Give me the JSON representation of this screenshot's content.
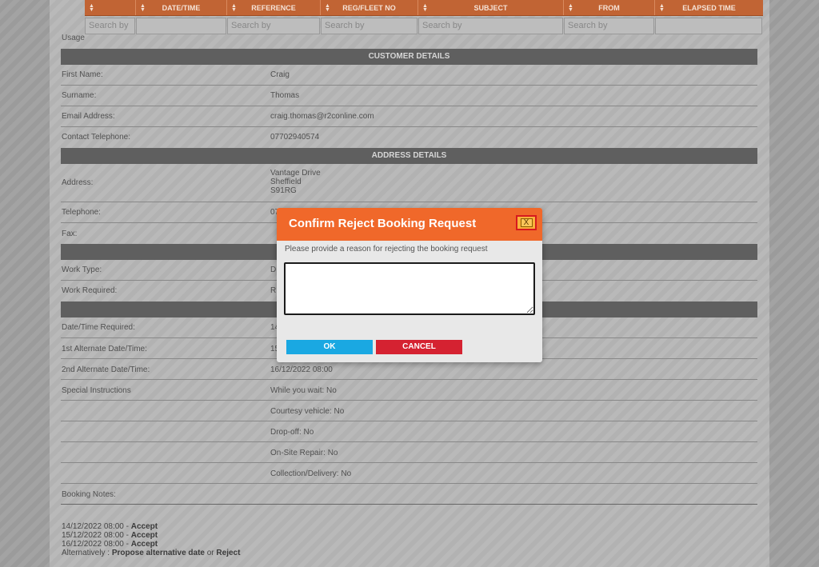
{
  "grid": {
    "columns": [
      {
        "label": ""
      },
      {
        "label": "DATE/TIME"
      },
      {
        "label": "REFERENCE"
      },
      {
        "label": "REG/FLEET NO"
      },
      {
        "label": "SUBJECT"
      },
      {
        "label": "FROM"
      },
      {
        "label": "ELAPSED TIME"
      }
    ],
    "search_placeholders": [
      "Search by",
      "",
      "Search by",
      "Search by",
      "Search by",
      "Search by",
      ""
    ]
  },
  "usage_label": "Usage",
  "customer": {
    "title": "CUSTOMER DETAILS",
    "rows": [
      {
        "label": "First Name:",
        "value": "Craig"
      },
      {
        "label": "Surname:",
        "value": "Thomas"
      },
      {
        "label": "Email Address:",
        "value": "craig.thomas@r2conline.com"
      },
      {
        "label": "Contact Telephone:",
        "value": "07702940574"
      }
    ]
  },
  "address": {
    "title": "ADDRESS DETAILS",
    "address_label": "Address:",
    "address_lines": [
      "Vantage Drive",
      "Sheffield",
      "S91RG"
    ],
    "telephone_label": "Telephone:",
    "telephone_value": "07",
    "fax_label": "Fax:"
  },
  "work": {
    "rows": [
      {
        "label": "Work Type:",
        "value": "D"
      },
      {
        "label": "Work Required:",
        "value": "R"
      }
    ]
  },
  "dates": {
    "rows": [
      {
        "label": "Date/Time Required:",
        "value": "14"
      },
      {
        "label": "1st Alternate Date/Time:",
        "value": "15"
      },
      {
        "label": "2nd Alternate Date/Time:",
        "value": "16/12/2022 08:00"
      },
      {
        "label": "Special Instructions",
        "value": "While you wait: No"
      },
      {
        "label": "",
        "value": "Courtesy vehicle: No"
      },
      {
        "label": "",
        "value": "Drop-off: No"
      },
      {
        "label": "",
        "value": "On-Site Repair: No"
      },
      {
        "label": "",
        "value": "Collection/Delivery: No"
      },
      {
        "label": "Booking Notes:",
        "value": ""
      }
    ]
  },
  "notes": [
    {
      "date": "14/12/2022 08:00 - ",
      "action": "Accept"
    },
    {
      "date": "15/12/2022 08:00 - ",
      "action": "Accept"
    },
    {
      "date": "16/12/2022 08:00 - ",
      "action": "Accept"
    }
  ],
  "alternatively": {
    "prefix": "Alternatively : ",
    "propose": "Propose alternative date",
    "or": " or ",
    "reject": "Reject"
  },
  "modal": {
    "title": "Confirm Reject Booking Request",
    "close_glyph": "X",
    "prompt": "Please provide a reason for rejecting the booking request",
    "reason_value": "",
    "ok_label": "OK",
    "cancel_label": "CANCEL"
  },
  "colors": {
    "modal_header": "#f0682a",
    "ok_button": "#1aa8e2",
    "cancel_button": "#d52231",
    "grid_header": "#c16434"
  }
}
